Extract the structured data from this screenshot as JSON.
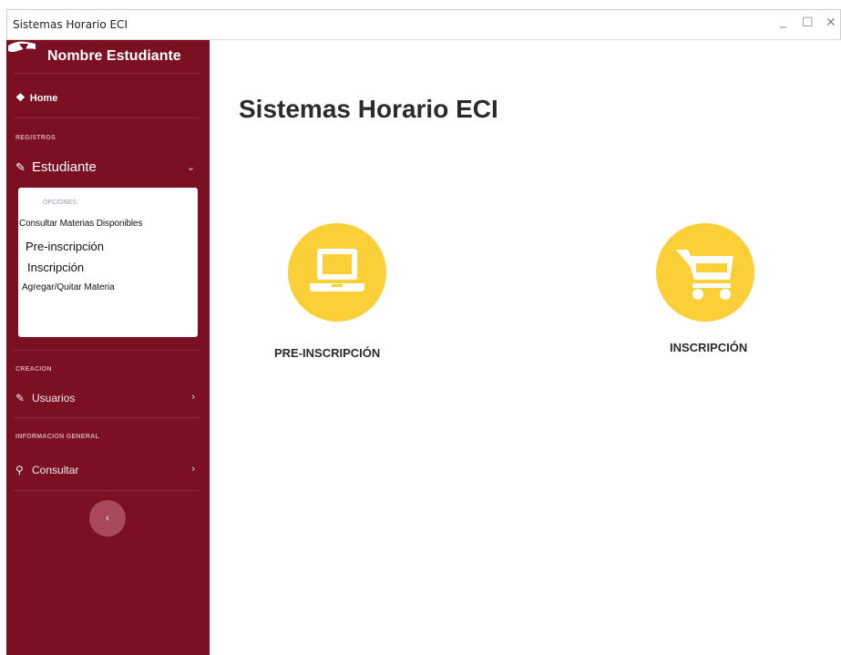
{
  "window": {
    "title": "Sistemas Horario ECI",
    "minimize": "_",
    "maximize": "☐",
    "close": "✕"
  },
  "sidebar": {
    "user_name": "Nombre Estudiante",
    "home_label": "Home",
    "sections": {
      "registros": "REGISTROS",
      "creacion": "CREACION",
      "informacion": "INFORMACION GENERAL"
    },
    "estudiante": {
      "label": "Estudiante",
      "submenu_heading": "OPCIONES:",
      "items": [
        "Consultar Materias Disponibles",
        "Pre-inscripción",
        "Inscripción",
        "Agregar/Quitar Materia"
      ]
    },
    "usuarios_label": "Usuarios",
    "consultar_label": "Consultar",
    "collapse_glyph": "‹"
  },
  "main": {
    "title": "Sistemas Horario ECI",
    "cards": [
      {
        "label": "PRE-INSCRIPCIÓN",
        "icon": "laptop-icon"
      },
      {
        "label": "INSCRIPCIÓN",
        "icon": "shopping-cart-icon"
      }
    ]
  },
  "colors": {
    "sidebar_bg": "#7a1021",
    "accent_yellow": "#fbcf37",
    "collapse_button": "#a94a5c"
  }
}
